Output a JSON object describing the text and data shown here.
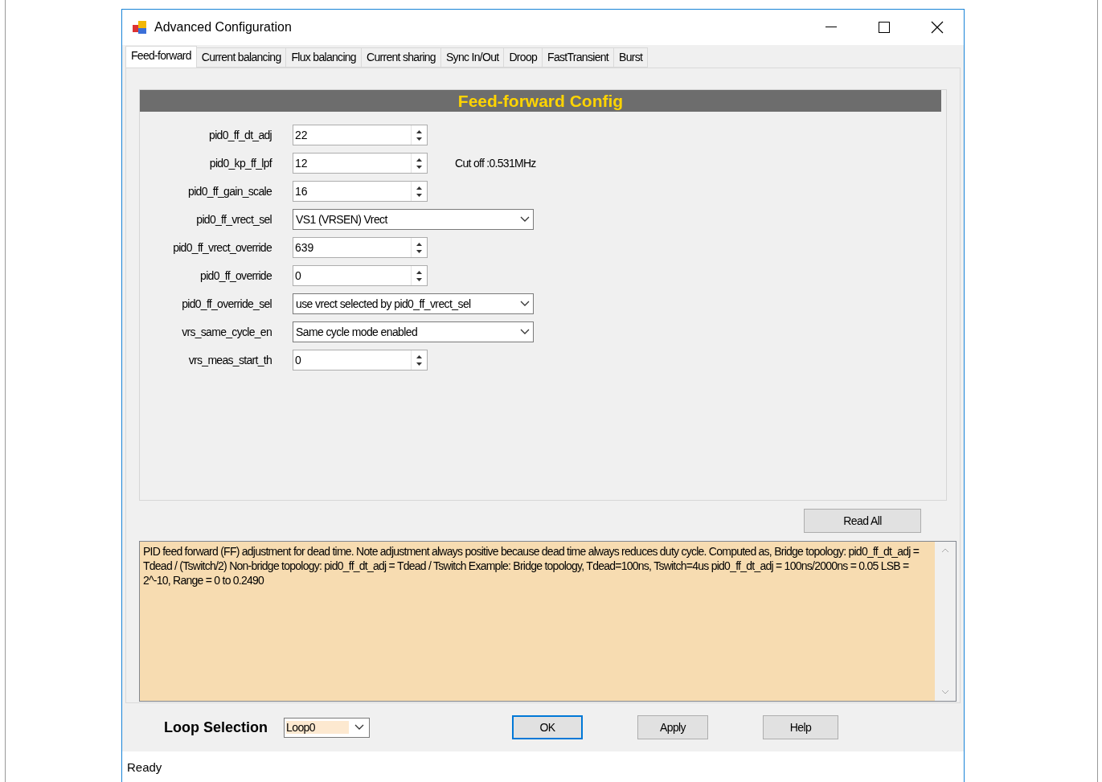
{
  "window": {
    "title": "Advanced Configuration"
  },
  "tabs": [
    {
      "label": "Feed-forward",
      "selected": true
    },
    {
      "label": "Current balancing",
      "selected": false
    },
    {
      "label": "Flux balancing",
      "selected": false
    },
    {
      "label": "Current sharing",
      "selected": false
    },
    {
      "label": "Sync In/Out",
      "selected": false
    },
    {
      "label": "Droop",
      "selected": false
    },
    {
      "label": "FastTransient",
      "selected": false
    },
    {
      "label": "Burst",
      "selected": false
    }
  ],
  "panel": {
    "title": "Feed-forward Config",
    "fields": [
      {
        "label": "pid0_ff_dt_adj",
        "kind": "spinner",
        "value": "22"
      },
      {
        "label": "pid0_kp_ff_lpf",
        "kind": "spinner",
        "value": "12",
        "note": "Cut off :0.531MHz"
      },
      {
        "label": "pid0_ff_gain_scale",
        "kind": "spinner",
        "value": "16"
      },
      {
        "label": "pid0_ff_vrect_sel",
        "kind": "combo",
        "value": "VS1 (VRSEN) Vrect"
      },
      {
        "label": "pid0_ff_vrect_override",
        "kind": "spinner",
        "value": "639"
      },
      {
        "label": "pid0_ff_override",
        "kind": "spinner",
        "value": "0"
      },
      {
        "label": "pid0_ff_override_sel",
        "kind": "combo",
        "value": "use vrect selected by pid0_ff_vrect_sel"
      },
      {
        "label": "vrs_same_cycle_en",
        "kind": "combo",
        "value": "Same cycle mode enabled"
      },
      {
        "label": "vrs_meas_start_th",
        "kind": "spinner",
        "value": "0"
      }
    ]
  },
  "read_all_button": "Read All",
  "description": "PID feed forward (FF) adjustment for dead time.  Note adjustment always positive because dead time always reduces duty cycle.  Computed as, Bridge topology: pid0_ff_dt_adj = Tdead / (Tswitch/2) Non-bridge topology: pid0_ff_dt_adj = Tdead / Tswitch Example: Bridge topology, Tdead=100ns, Tswitch=4us pid0_ff_dt_adj = 100ns/2000ns = 0.05 LSB = 2^-10, Range = 0 to 0.2490",
  "footer": {
    "loop_label": "Loop Selection",
    "loop_value": "Loop0",
    "buttons": [
      "OK",
      "Apply",
      "Help"
    ]
  },
  "status_bar": "Ready"
}
